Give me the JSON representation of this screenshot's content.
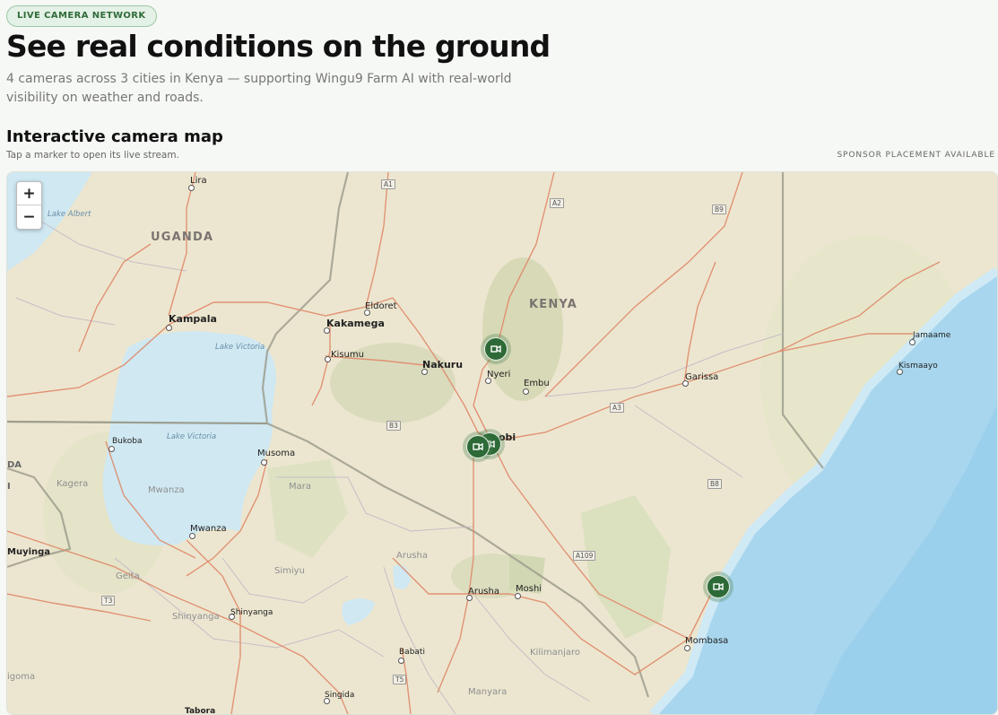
{
  "header": {
    "badge": "LIVE CAMERA NETWORK",
    "title": "See real conditions on the ground",
    "subtitle": "4 cameras across 3 cities in Kenya — supporting Wingu9 Farm AI with real-world visibility on weather and roads."
  },
  "map_section": {
    "title": "Interactive camera map",
    "hint": "Tap a marker to open its live stream.",
    "sponsor": "SPONSOR PLACEMENT AVAILABLE"
  },
  "map": {
    "zoom_in": "+",
    "zoom_out": "−",
    "countries": {
      "uganda": "UGANDA",
      "kenya": "KENYA"
    },
    "cities": {
      "lira": "Lira",
      "kampala": "Kampala",
      "eldoret": "Eldoret",
      "kakamega": "Kakamega",
      "kisumu": "Kisumu",
      "nakuru": "Nakuru",
      "nyeri": "Nyeri",
      "embu": "Embu",
      "nairobi_partial": "obi",
      "garissa": "Garissa",
      "jamaame": "Jamaame",
      "kismaayo": "Kismaayo",
      "bukoba": "Bukoba",
      "musoma": "Musoma",
      "mwanza": "Mwanza",
      "muyinga": "Muyinga",
      "arusha": "Arusha",
      "moshi": "Moshi",
      "mombasa": "Mombasa",
      "shinyanga": "Shinyanga",
      "babati": "Babati",
      "singida": "Singida",
      "tabora_partial": "Tabora"
    },
    "regions": {
      "kagera": "Kagera",
      "mwanza_region": "Mwanza",
      "mara": "Mara",
      "geita": "Geita",
      "simiyu": "Simiyu",
      "shinyanga_region": "Shinyanga",
      "arusha_region": "Arusha",
      "kilimanjaro": "Kilimanjaro",
      "manyara": "Manyara",
      "igoma_partial": "igoma",
      "da_partial": "DA",
      "i_partial": "I"
    },
    "water": {
      "lake_albert": "Lake Albert",
      "lake_victoria_1": "Lake Victoria",
      "lake_victoria_2": "Lake Victoria"
    },
    "roads": [
      "A1",
      "A2",
      "B9",
      "A3",
      "B3",
      "B8",
      "A109",
      "T3",
      "T5"
    ],
    "markers": [
      {
        "name": "Nyeri camera"
      },
      {
        "name": "Nairobi camera 1"
      },
      {
        "name": "Nairobi camera 2"
      },
      {
        "name": "Mombasa coast camera"
      }
    ]
  }
}
